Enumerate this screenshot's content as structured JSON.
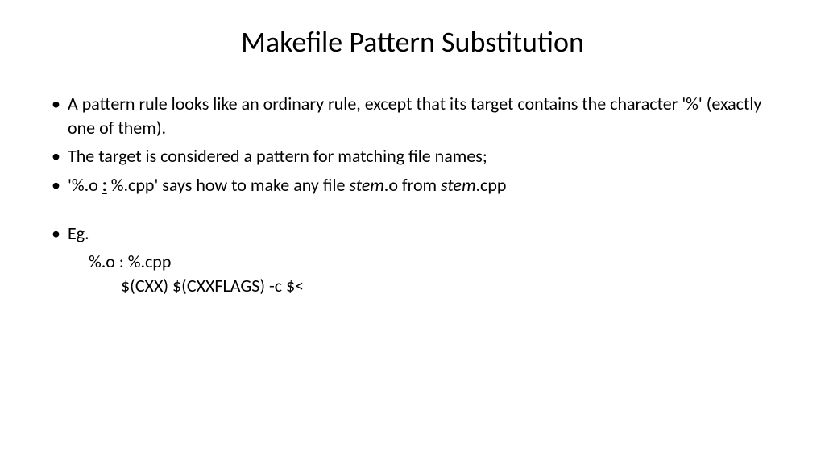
{
  "slide": {
    "title": "Makefile Pattern Substitution",
    "bullets": {
      "b1_part1": " A pattern rule looks like an ordinary rule, except that its target contains the character '%' (exactly one of them).",
      "b2": "The target is considered a pattern for matching file names;",
      "b3_part1": "'%.o ",
      "b3_colon": ":",
      "b3_part2": " %.cpp' says how to make any file ",
      "b3_stem1": "stem",
      "b3_part3": ".o from  ",
      "b3_stem2": "stem",
      "b3_part4": ".cpp",
      "b4": "Eg."
    },
    "code": {
      "line1": "%.o : %.cpp",
      "line2": "$(CXX) $(CXXFLAGS) -c $<"
    }
  }
}
